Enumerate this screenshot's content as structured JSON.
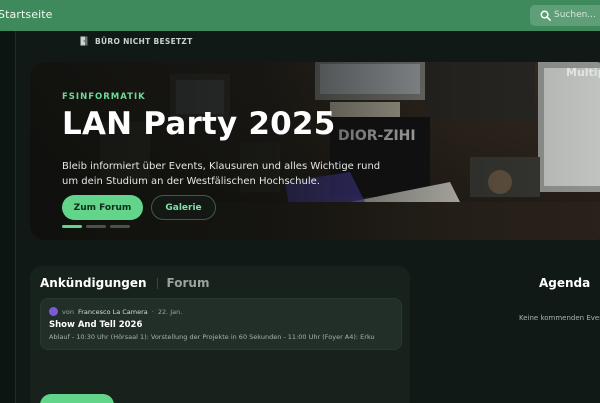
{
  "topbar": {
    "title": "Startseite",
    "search_placeholder": "Suchen..."
  },
  "status": {
    "office_label": "BÜRO NICHT BESETZT"
  },
  "hero": {
    "kicker": "FSINFORMATIK",
    "headline": "LAN Party 2025",
    "description": "Bleib informiert über Events, Klausuren und alles Wichtige rund um dein Studium an der Westfälischen Hochschule.",
    "primary_button": "Zum Forum",
    "secondary_button": "Galerie",
    "side_text": "Multip",
    "slides": {
      "count": 3,
      "active_index": 0
    }
  },
  "announcements": {
    "tabs": [
      {
        "label": "Ankündigungen",
        "active": true
      },
      {
        "label": "Forum",
        "active": false
      }
    ],
    "items": [
      {
        "by_prefix": "von",
        "author": "Francesco La Camera",
        "separator": "·",
        "date": "22. Jan.",
        "title": "Show And Tell 2026",
        "body": "Ablauf - 10:30 Uhr (Hörsaal 1): Vorstellung der Projekte in 60 Sekunden - 11:00 Uhr (Foyer A4): Erku"
      }
    ]
  },
  "agenda": {
    "title": "Agenda",
    "empty_text": "Keine kommenden Event"
  },
  "colors": {
    "topbar": "#3f8a5c",
    "accent": "#62d58b",
    "background": "#101915",
    "panel": "#18221d"
  },
  "icons": {
    "search": "search-icon",
    "office": "door-icon",
    "avatar": "avatar-icon"
  }
}
